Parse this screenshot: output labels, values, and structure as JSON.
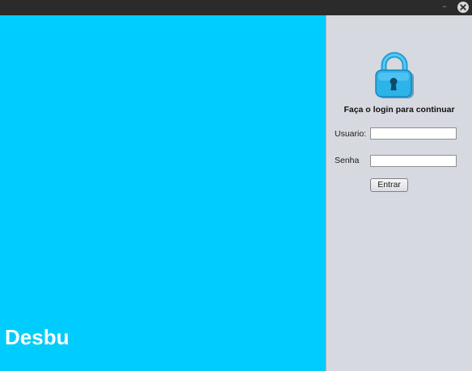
{
  "window": {
    "title_bar": {
      "minimize_glyph": "–",
      "close_icon": "close-icon"
    }
  },
  "left_panel": {
    "brand": "Desbu",
    "color": "#00ccff"
  },
  "login": {
    "icon": "lock-icon",
    "heading": "Faça o login para continuar",
    "username_label": "Usuario:",
    "username_value": "",
    "password_label": "Senha",
    "password_value": "",
    "submit_label": "Entrar"
  }
}
